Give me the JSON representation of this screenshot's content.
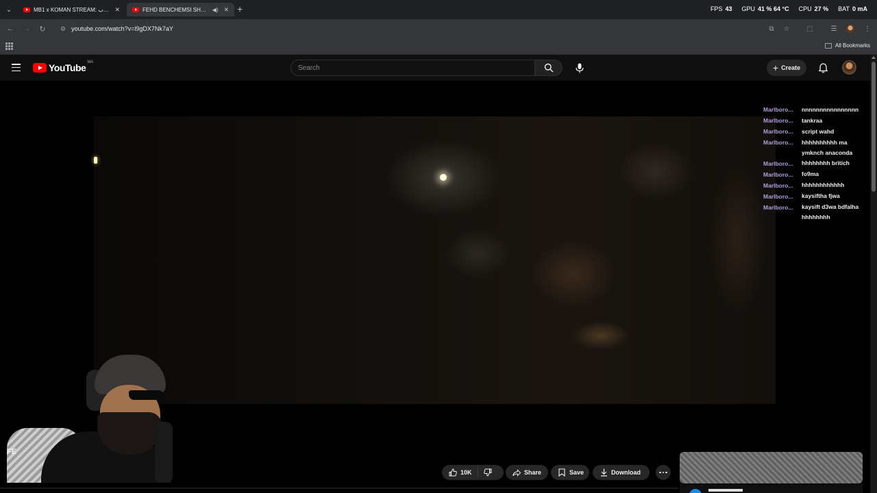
{
  "browser": {
    "tabs": [
      {
        "title": "MB1 x KOMAN STREAM: الراب..."
      },
      {
        "title": "FEHD BENCHEMSI SHORT..."
      }
    ],
    "url": "youtube.com/watch?v=l9gDX7Nk7aY",
    "all_bookmarks": "All Bookmarks"
  },
  "overlay": {
    "fps_label": "FPS",
    "fps_value": "43",
    "gpu_label": "GPU",
    "gpu_value": "41 % 64 °C",
    "cpu_label": "CPU",
    "cpu_value": "27 %",
    "bat_label": "BAT",
    "bat_value": "0 mA"
  },
  "youtube": {
    "logo_text": "YouTube",
    "country_code": "MA",
    "search_placeholder": "Search",
    "create_label": "Create"
  },
  "chat": [
    {
      "user": "Marlboro...",
      "text": "nnnnnnnnnnnnnnnn"
    },
    {
      "user": "Marlboro...",
      "text": "tankraa"
    },
    {
      "user": "Marlboro...",
      "text": "script wahd"
    },
    {
      "user": "Marlboro...",
      "text": "hhhhhhhhhh ma ymknch anaconda"
    },
    {
      "user": "Marlboro...",
      "text": "hhhhhhhh britich"
    },
    {
      "user": "Marlboro...",
      "text": "fo9ma"
    },
    {
      "user": "Marlboro...",
      "text": "hhhhhhhhhhhh"
    },
    {
      "user": "Marlboro...",
      "text": "kaysiftha fjwa"
    },
    {
      "user": "Marlboro...",
      "text": "kaysift d3wa bdfalha hhhhhhhh"
    }
  ],
  "webcam_overlay_text": "FE",
  "actions": {
    "like_count": "10K",
    "share_label": "Share",
    "save_label": "Save",
    "download_label": "Download"
  },
  "colors": {
    "youtube_red": "#ff0000",
    "chat_username": "#b39ddb",
    "pill_bg": "#272727",
    "page_bg": "#0f0f0f"
  }
}
